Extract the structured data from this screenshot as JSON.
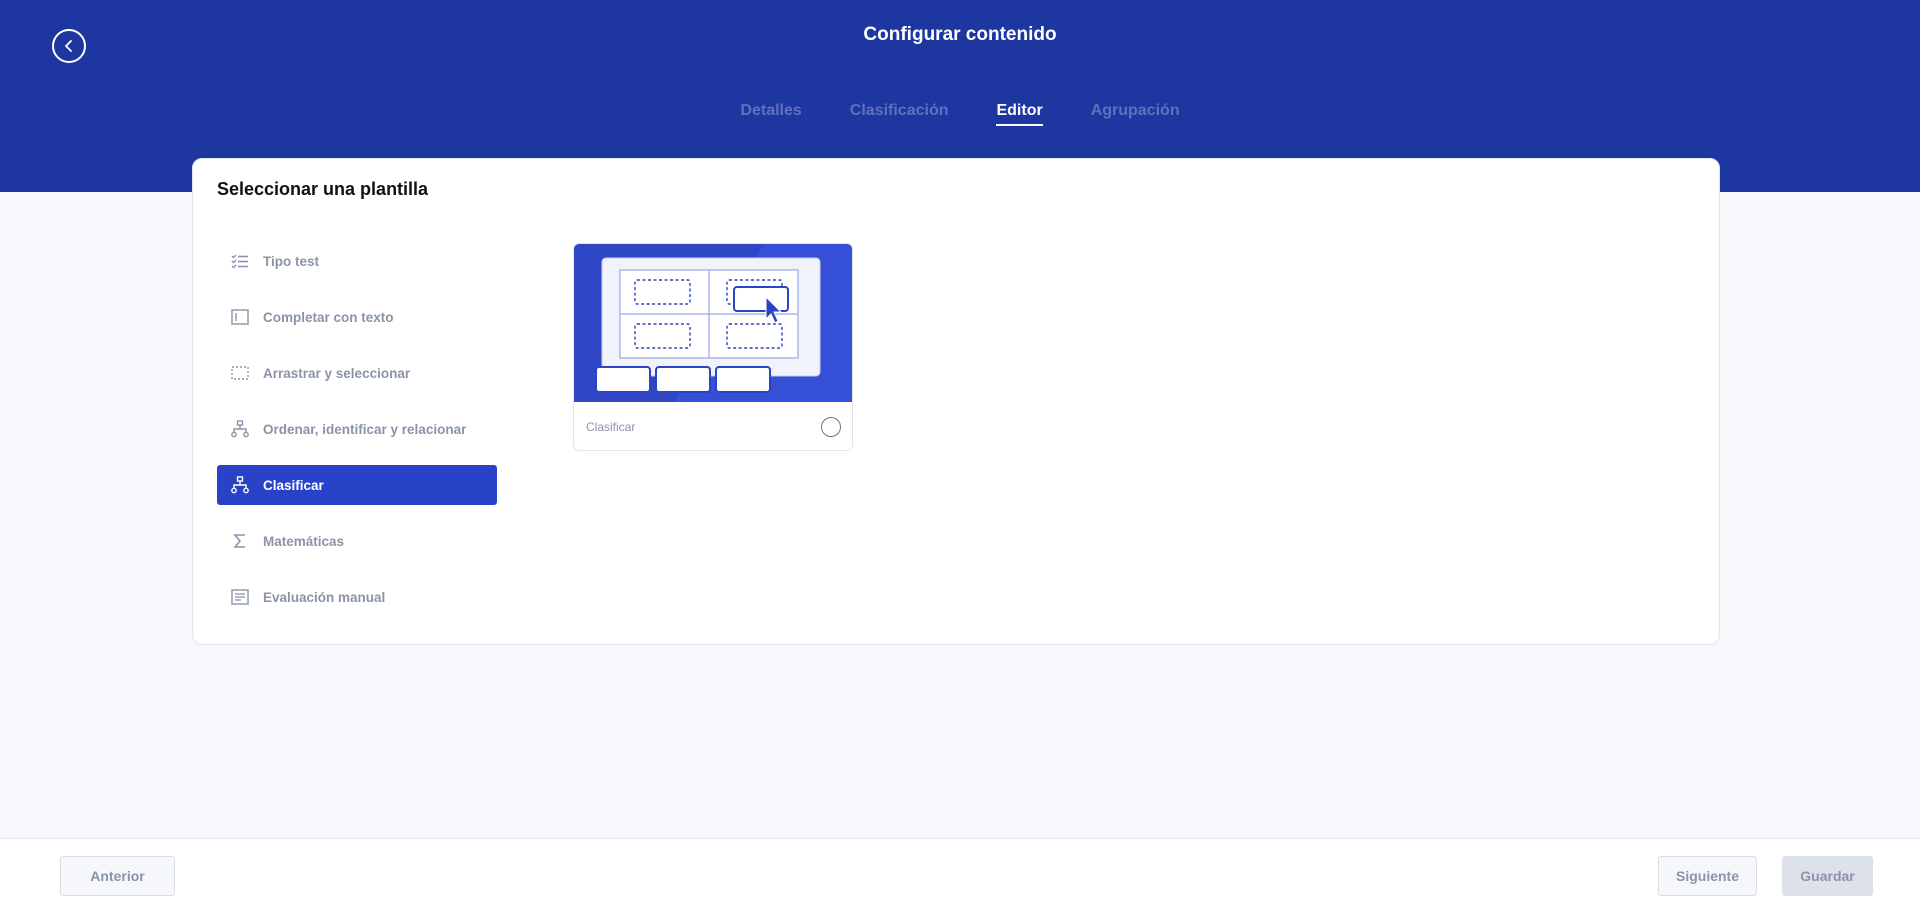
{
  "header": {
    "title": "Configurar contenido",
    "back_icon": "chevron-left-icon",
    "tabs": [
      {
        "label": "Detalles",
        "active": false
      },
      {
        "label": "Clasificación",
        "active": false
      },
      {
        "label": "Editor",
        "active": true
      },
      {
        "label": "Agrupación",
        "active": false
      }
    ]
  },
  "card": {
    "title": "Seleccionar una plantilla",
    "menu": [
      {
        "label": "Tipo test",
        "icon": "checklist-icon",
        "active": false
      },
      {
        "label": "Completar con texto",
        "icon": "text-cursor-icon",
        "active": false
      },
      {
        "label": "Arrastrar y seleccionar",
        "icon": "dashed-box-icon",
        "active": false
      },
      {
        "label": "Ordenar, identificar y relacionar",
        "icon": "hierarchy-icon",
        "active": false
      },
      {
        "label": "Clasificar",
        "icon": "hierarchy-icon",
        "active": true
      },
      {
        "label": "Matemáticas",
        "icon": "sigma-icon",
        "active": false
      },
      {
        "label": "Evaluación manual",
        "icon": "document-icon",
        "active": false
      }
    ],
    "template": {
      "label": "Clasificar",
      "selected": false
    }
  },
  "footer": {
    "prev_label": "Anterior",
    "next_label": "Siguiente",
    "save_label": "Guardar"
  },
  "colors": {
    "header_bg": "#1e36a0",
    "accent": "#2843c8",
    "page_bg": "#f6f8fc"
  }
}
